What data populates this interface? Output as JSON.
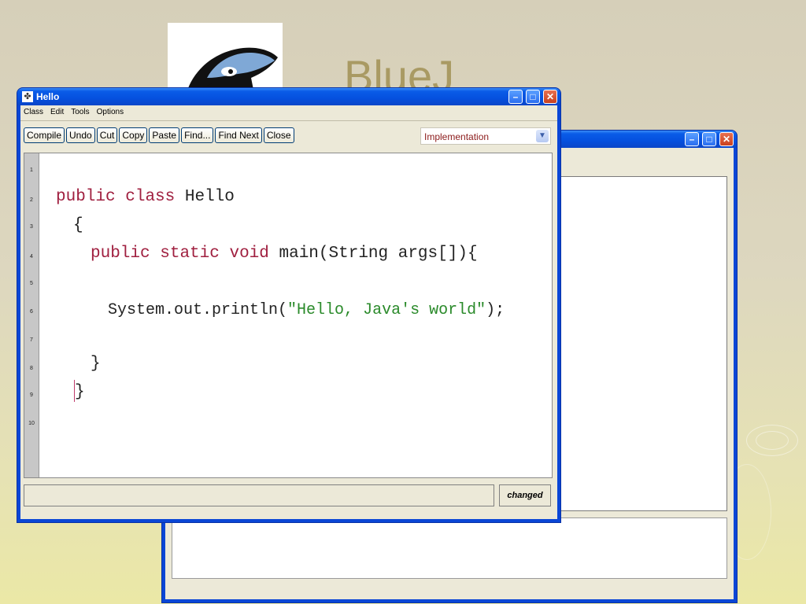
{
  "app": {
    "title": "BlueJ"
  },
  "back_window": {
    "title": ""
  },
  "editor_window": {
    "title": "Hello",
    "menu": [
      "Class",
      "Edit",
      "Tools",
      "Options"
    ],
    "toolbar": [
      "Compile",
      "Undo",
      "Cut",
      "Copy",
      "Paste",
      "Find...",
      "Find Next",
      "Close"
    ],
    "view_select": "Implementation",
    "line_numbers": [
      "1",
      "2",
      "3",
      "4",
      "5",
      "6",
      "7",
      "8",
      "9",
      "10"
    ],
    "code": {
      "l2_kw1": "public",
      "l2_kw2": "class",
      "l2_name": "Hello",
      "l3": "{",
      "l4_kw1": "public",
      "l4_kw2": "static",
      "l4_kw3": "void",
      "l4_rest": "main(String args[]){",
      "l6_pre": "System.out.println(",
      "l6_str": "\"Hello, Java's world\"",
      "l6_post": ");",
      "l8": "}",
      "l9": "}"
    },
    "status_text": "",
    "status_changed": "changed"
  },
  "icons": {
    "window_icon": "bluej-app-icon",
    "minimize": "minimize-icon",
    "maximize": "maximize-icon",
    "close": "close-icon",
    "dropdown": "chevron-down-icon"
  }
}
